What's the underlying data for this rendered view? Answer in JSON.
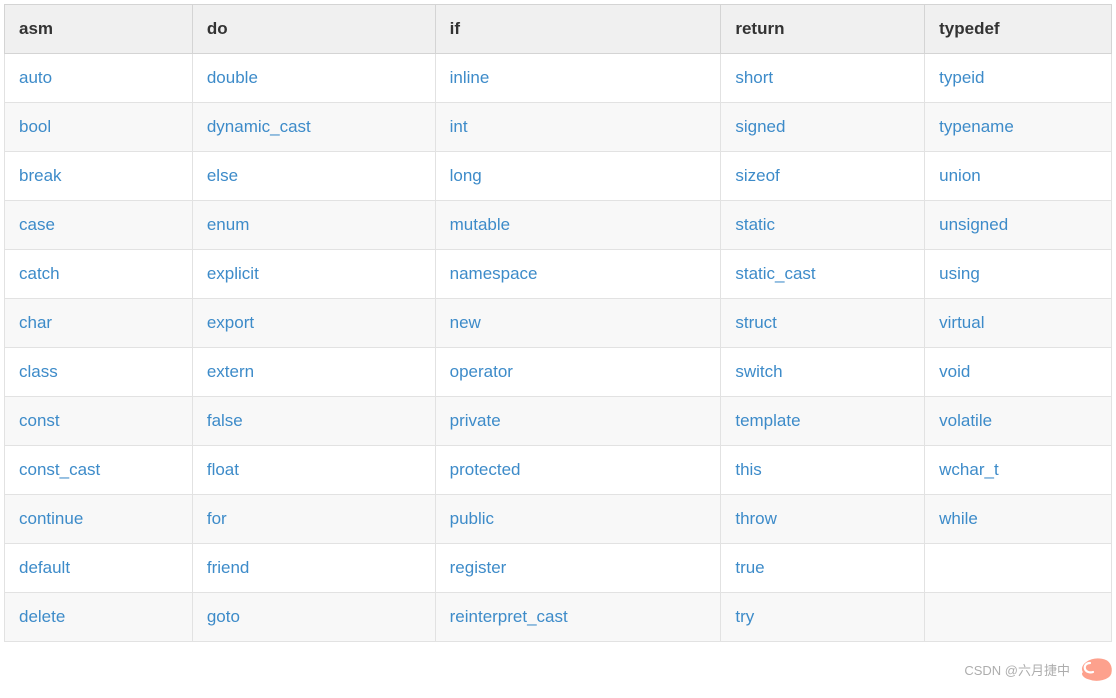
{
  "table": {
    "headers": [
      "asm",
      "do",
      "if",
      "return",
      "typedef"
    ],
    "rows": [
      [
        "auto",
        "double",
        "inline",
        "short",
        "typeid"
      ],
      [
        "bool",
        "dynamic_cast",
        "int",
        "signed",
        "typename"
      ],
      [
        "break",
        "else",
        "long",
        "sizeof",
        "union"
      ],
      [
        "case",
        "enum",
        "mutable",
        "static",
        "unsigned"
      ],
      [
        "catch",
        "explicit",
        "namespace",
        "static_cast",
        "using"
      ],
      [
        "char",
        "export",
        "new",
        "struct",
        "virtual"
      ],
      [
        "class",
        "extern",
        "operator",
        "switch",
        "void"
      ],
      [
        "const",
        "false",
        "private",
        "template",
        "volatile"
      ],
      [
        "const_cast",
        "float",
        "protected",
        "this",
        "wchar_t"
      ],
      [
        "continue",
        "for",
        "public",
        "throw",
        "while"
      ],
      [
        "default",
        "friend",
        "register",
        "true",
        ""
      ],
      [
        "delete",
        "goto",
        "reinterpret_cast",
        "try",
        ""
      ]
    ]
  },
  "watermark": {
    "text": "CSDN @六月捷中"
  }
}
